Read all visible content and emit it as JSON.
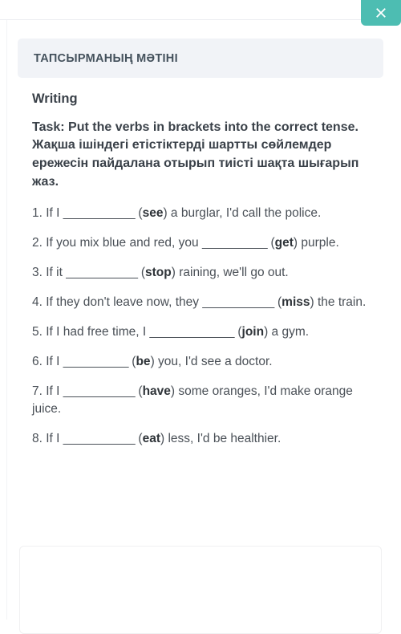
{
  "window": {
    "close_button": {
      "label": "×",
      "icon": "close-icon",
      "color": "#4dbdb2"
    }
  },
  "modal": {
    "title": "ТАПСЫРМАНЫҢ МӘТІНІ",
    "title_band_color": "#f1f3f7"
  },
  "content": {
    "section_heading": "Writing",
    "task_intro": "Task: Put the verbs in brackets into the correct tense. Жақша ішіндегі етістіктерді шартты сөйлемдер ережесін пайдалана отырып тиісті шақта шығарып жаз.",
    "questions": [
      {
        "number": "1.",
        "before": "If I",
        "blank": "___________",
        "verb": "see",
        "after": "a burglar, I'd call the police."
      },
      {
        "number": "2.",
        "before": "If you mix blue and red, you",
        "blank": "__________",
        "verb": "get",
        "after": "purple."
      },
      {
        "number": "3.",
        "before": "If it",
        "blank": "___________",
        "verb": "stop",
        "after": "raining, we'll go out."
      },
      {
        "number": "4.",
        "before": "If they don't leave now, they",
        "blank": "___________",
        "verb": "miss",
        "after": "the train."
      },
      {
        "number": "5.",
        "before": "If I had free time, I",
        "blank": "_____________",
        "verb": "join",
        "after": "a gym."
      },
      {
        "number": "6.",
        "before": "If I",
        "blank": "__________",
        "verb": "be",
        "after": "you, I'd see a doctor."
      },
      {
        "number": "7.",
        "before": "If I",
        "blank": "___________",
        "verb": "have",
        "after": "some oranges, I'd make orange juice."
      },
      {
        "number": "8.",
        "before": "If I",
        "blank": "___________",
        "verb": "eat",
        "after": "less, I'd be healthier."
      }
    ]
  },
  "answer_area": {
    "placeholder": ""
  }
}
